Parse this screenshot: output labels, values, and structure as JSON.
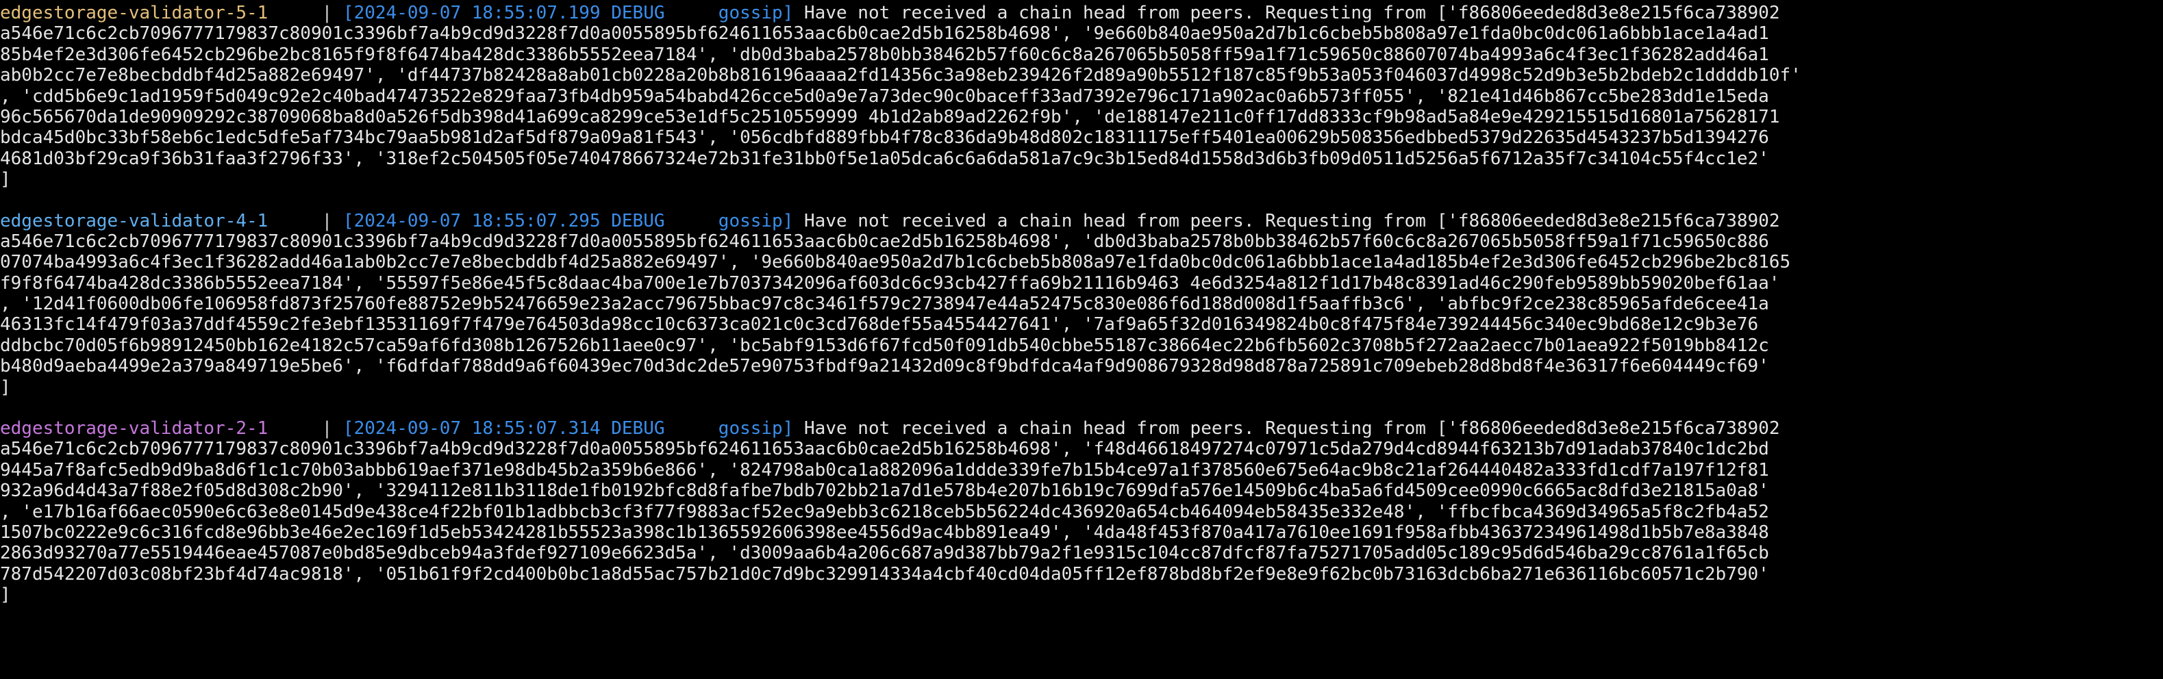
{
  "colors": {
    "background": "#000000",
    "text": "#e5e5e5",
    "timestamp_blue": "#3b8eea",
    "validator_5": "#e5c07b",
    "validator_4": "#61afef",
    "validator_2": "#c678dd"
  },
  "entries": [
    {
      "service": "edgestorage-validator-5-1",
      "color_key": "validator_5",
      "separator": "     | ",
      "meta": "[2024-09-07 18:55:07.199 DEBUG     gossip]",
      "first_msg": " Have not received a chain head from peers. Requesting from ['f86806eeded8d3e8e215f6ca738902",
      "lines": [
        "a546e71c6c2cb7096777179837c80901c3396bf7a4b9cd9d3228f7d0a0055895bf624611653aac6b0cae2d5b16258b4698', '9e660b840ae950a2d7b1c6cbeb5b808a97e1fda0bc0dc061a6bbb1ace1a4ad1",
        "85b4ef2e3d306fe6452cb296be2bc8165f9f8f6474ba428dc3386b5552eea7184', 'db0d3baba2578b0bb38462b57f60c6c8a267065b5058ff59a1f71c59650c88607074ba4993a6c4f3ec1f36282add46a1",
        "ab0b2cc7e7e8becbddbf4d25a882e69497', 'df44737b82428a8ab01cb0228a20b8b816196aaaa2fd14356c3a98eb239426f2d89a90b5512f187c85f9b53a053f046037d4998c52d9b3e5b2bdeb2c1ddddb10f'",
        ", 'cdd5b6e9c1ad1959f5d049c92e2c40bad47473522e829faa73fb4db959a54babd426cce5d0a9e7a73dec90c0baceff33ad7392e796c171a902ac0a6b573ff055', '821e41d46b867cc5be283dd1e15eda",
        "96c565670da1de90909292c38709068ba8d0a526f5db398d41a699ca8299ce53e1df5c2510559999 4b1d2ab89ad2262f9b', 'de188147e211c0ff17dd8333cf9b98ad5a84e9e429215515d16801a75628171",
        "bdca45d0bc33bf58eb6c1edc5dfe5af734bc79aa5b981d2af5df879a09a81f543', '056cdbfd889fbb4f78c836da9b48d802c18311175eff5401ea00629b508356edbbed5379d22635d4543237b5d1394276",
        "4681d03bf29ca9f36b31faa3f2796f33', '318ef2c504505f05e740478667324e72b31fe31bb0f5e1a05dca6c6a6da581a7c9c3b15ed84d1558d3d6b3fb09d0511d5256a5f6712a35f7c34104c55f4cc1e2'",
        "]"
      ]
    },
    {
      "service": "edgestorage-validator-4-1",
      "color_key": "validator_4",
      "separator": "     | ",
      "meta": "[2024-09-07 18:55:07.295 DEBUG     gossip]",
      "first_msg": " Have not received a chain head from peers. Requesting from ['f86806eeded8d3e8e215f6ca738902",
      "lines": [
        "a546e71c6c2cb7096777179837c80901c3396bf7a4b9cd9d3228f7d0a0055895bf624611653aac6b0cae2d5b16258b4698', 'db0d3baba2578b0bb38462b57f60c6c8a267065b5058ff59a1f71c59650c886",
        "07074ba4993a6c4f3ec1f36282add46a1ab0b2cc7e7e8becbddbf4d25a882e69497', '9e660b840ae950a2d7b1c6cbeb5b808a97e1fda0bc0dc061a6bbb1ace1a4ad185b4ef2e3d306fe6452cb296be2bc8165",
        "f9f8f6474ba428dc3386b5552eea7184', '55597f5e86e45f5c8daac4ba700e1e7b7037342096af603dc6c93cb427ffa69b21116b9463 4e6d3254a812f1d17b48c8391ad46c290feb9589bb59020bef61aa'",
        ", '12d41f0600db06fe106958fd873f25760fe88752e9b52476659e23a2acc79675bbac97c8c3461f579c2738947e44a52475c830e086f6d188d008d1f5aaffb3c6', 'abfbc9f2ce238c85965afde6cee41a",
        "46313fc14f479f03a37ddf4559c2fe3ebf13531169f7f479e764503da98cc10c6373ca021c0c3cd768def55a4554427641', '7af9a65f32d016349824b0c8f475f84e739244456c340ec9bd68e12c9b3e76",
        "ddbcbc70d05f6b98912450bb162e4182c57ca59af6fd308b1267526b11aee0c97', 'bc5abf9153d6f67fcd50f091db540cbbe55187c38664ec22b6fb5602c3708b5f272aa2aecc7b01aea922f5019bb8412c",
        "b480d9aeba4499e2a379a849719e5be6', 'f6dfdaf788dd9a6f60439ec70d3dc2de57e90753fbdf9a21432d09c8f9bdfdca4af9d908679328d98d878a725891c709ebeb28d8bd8f4e36317f6e604449cf69'",
        "]"
      ]
    },
    {
      "service": "edgestorage-validator-2-1",
      "color_key": "validator_2",
      "separator": "     | ",
      "meta": "[2024-09-07 18:55:07.314 DEBUG     gossip]",
      "first_msg": " Have not received a chain head from peers. Requesting from ['f86806eeded8d3e8e215f6ca738902",
      "lines": [
        "a546e71c6c2cb7096777179837c80901c3396bf7a4b9cd9d3228f7d0a0055895bf624611653aac6b0cae2d5b16258b4698', 'f48d46618497274c07971c5da279d4cd8944f63213b7d91adab37840c1dc2bd",
        "9445a7f8afc5edb9d9ba8d6f1c1c70b03abbb619aef371e98db45b2a359b6e866', '824798ab0ca1a882096a1ddde339fe7b15b4ce97a1f378560e675e64ac9b8c21af264440482a333fd1cdf7a197f12f81",
        "932a96d4d43a7f88e2f05d8d308c2b90', '3294112e811b3118de1fb0192bfc8d8fafbe7bdb702bb21a7d1e578b4e207b16b19c7699dfa576e14509b6c4ba5a6fd4509cee0990c6665ac8dfd3e21815a0a8'",
        ", 'e17b16af66aec0590e6c63e8e0145d9e438ce4f22bf01b1adbbcb3cf3f77f9883acf52ec9a9ebb3c6218ceb5b56224dc436920a654cb464094eb58435e332e48', 'ffbcfbca4369d34965a5f8c2fb4a52",
        "1507bc0222e9c6c316fcd8e96bb3e46e2ec169f1d5eb53424281b55523a398c1b1365592606398ee4556d9ac4bb891ea49', '4da48f453f870a417a7610ee1691f958afbb43637234961498d1b5b7e8a3848",
        "2863d93270a77e5519446eae457087e0bd85e9dbceb94a3fdef927109e6623d5a', 'd3009aa6b4a206c687a9d387bb79a2f1e9315c104cc87dfcf87fa75271705add05c189c95d6d546ba29cc8761a1f65cb",
        "787d542207d03c08bf23bf4d74ac9818', '051b61f9f2cd400b0bc1a8d55ac757b21d0c7d9bc329914334a4cbf40cd04da05ff12ef878bd8bf2ef9e8e9f62bc0b73163dcb6ba271e636116bc60571c2b790'",
        "]"
      ]
    }
  ]
}
